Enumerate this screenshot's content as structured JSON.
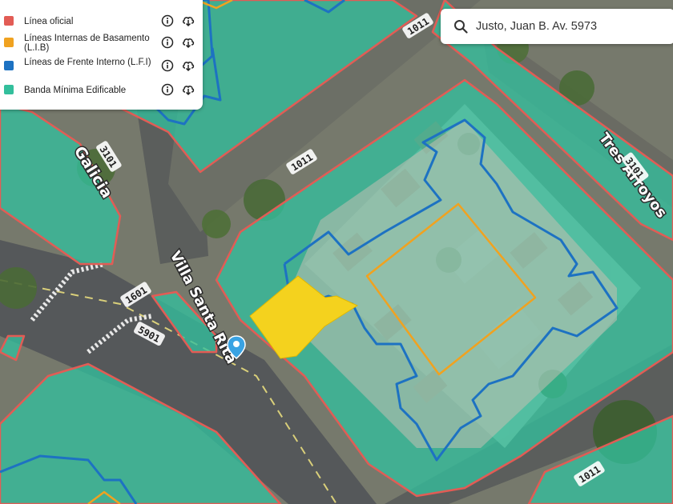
{
  "legend": {
    "items": [
      {
        "label": "Línea oficial",
        "color": "#e25c55"
      },
      {
        "label": "Líneas Internas de Basamento (L.I.B)",
        "color": "#f0a220"
      },
      {
        "label": "Líneas de Frente Interno (L.F.I)",
        "color": "#1d72c2"
      },
      {
        "label": "Banda Mínima Edificable",
        "color": "#33bf9c"
      }
    ],
    "info_icon": "info-circle-icon",
    "download_icon": "cloud-download-icon"
  },
  "search": {
    "value": "Justo, Juan B. Av. 5973",
    "icon": "search-icon"
  },
  "map": {
    "streets": {
      "galicia": "Galicia",
      "villa_santa_rita": "Villa Santa Rita",
      "tres_arroyos": "Tres Arroyos"
    },
    "number_tags": {
      "top": "1011",
      "middle_block": "1011",
      "bottom_right": "1011",
      "galicia": "3101",
      "tres_arroyos": "3101",
      "villa_santa_rita": "1601",
      "avenue": "5901"
    },
    "marker_icon": "location-pin-icon",
    "colors": {
      "banda": "#33bf9c",
      "linea_oficial": "#e25c55",
      "lib": "#f0a220",
      "lfi": "#1d72c2",
      "selected_parcel": "#f4d21e"
    }
  }
}
